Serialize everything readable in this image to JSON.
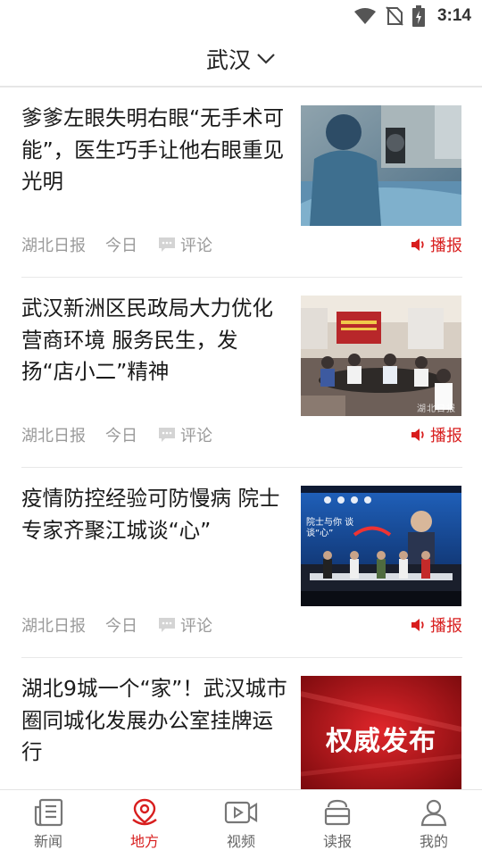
{
  "status_bar": {
    "time": "3:14",
    "icons": [
      "wifi-icon",
      "no-sim-icon",
      "battery-charging-icon"
    ]
  },
  "header": {
    "city": "武汉",
    "dropdown_icon": "chevron-down-icon"
  },
  "news": [
    {
      "title": "爹爹左眼失明右眼“无手术可能”，医生巧手让他右眼重见光明",
      "source": "湖北日报",
      "time": "今日",
      "comment_label": "评论",
      "broadcast_label": "播报",
      "image": "eye-surgery-photo"
    },
    {
      "title": "武汉新洲区民政局大力优化营商环境 服务民生，发扬“店小二”精神",
      "source": "湖北日报",
      "time": "今日",
      "comment_label": "评论",
      "broadcast_label": "播报",
      "image": "meeting-room-photo",
      "watermark": "湖北日报"
    },
    {
      "title": "疫情防控经验可防慢病 院士专家齐聚江城谈“心”",
      "source": "湖北日报",
      "time": "今日",
      "comment_label": "评论",
      "broadcast_label": "播报",
      "image": "forum-stage-photo",
      "image_text": "院士与你 谈谈“心”"
    },
    {
      "title": "湖北9城一个“家”！武汉城市圈同城化发展办公室挂牌运行",
      "image": "authority-release-banner",
      "image_text": "权威发布"
    }
  ],
  "tabbar": [
    {
      "label": "新闻",
      "icon": "newspaper-icon",
      "active": false
    },
    {
      "label": "地方",
      "icon": "location-pin-icon",
      "active": true
    },
    {
      "label": "视频",
      "icon": "video-icon",
      "active": false
    },
    {
      "label": "读报",
      "icon": "reading-icon",
      "active": false
    },
    {
      "label": "我的",
      "icon": "user-icon",
      "active": false
    }
  ],
  "colors": {
    "accent": "#d81e1e",
    "meta_text": "#9a9a9a",
    "divider": "#e8e8e8"
  }
}
